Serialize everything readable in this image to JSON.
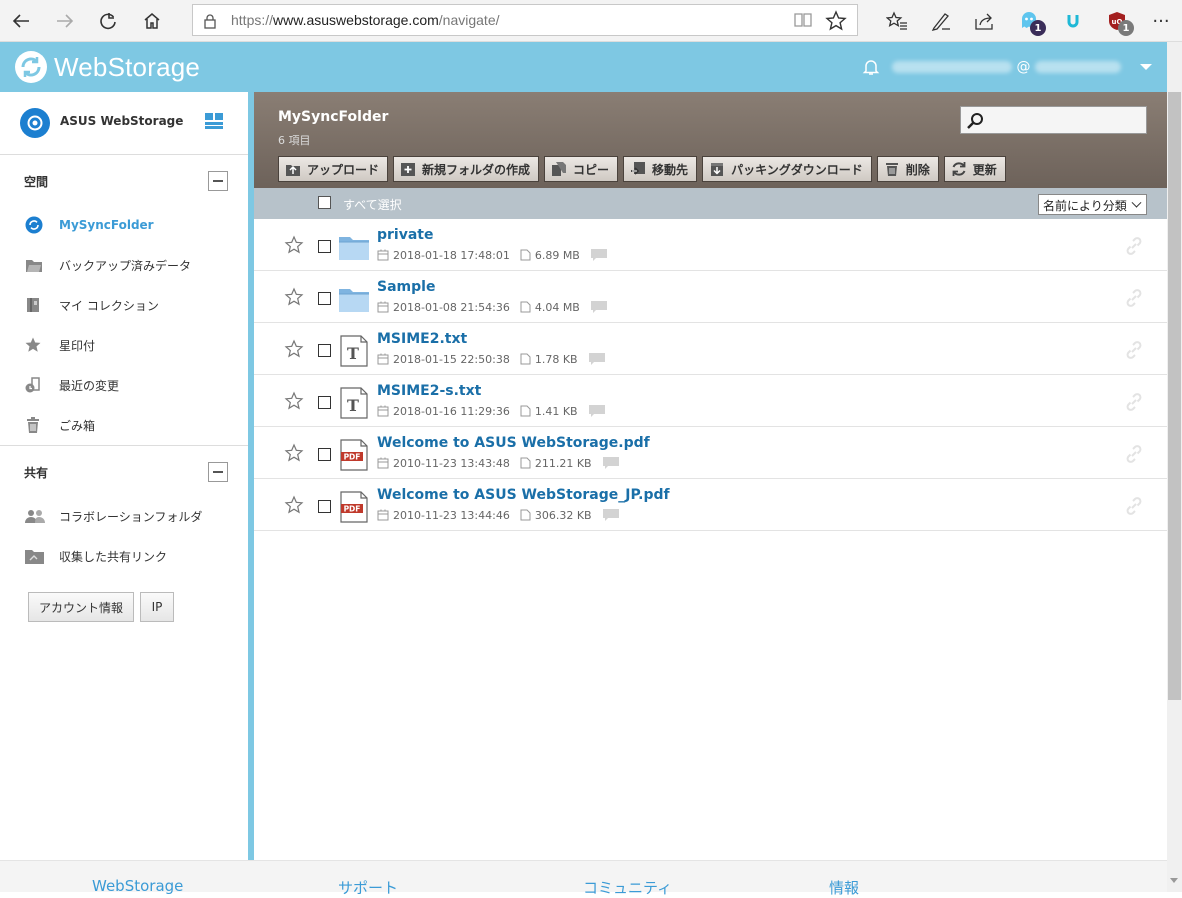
{
  "browser": {
    "url_prefix": "https://",
    "url_host": "www.asuswebstorage.com",
    "url_path": "/navigate/",
    "badge_ghostery": "1",
    "badge_ublock": "1",
    "more": "···"
  },
  "header": {
    "logo_text": "WebStorage",
    "user_at": "@"
  },
  "sidebar": {
    "brand": "ASUS WebStorage",
    "space_heading": "空間",
    "items": [
      {
        "label": "MySyncFolder",
        "icon": "sync-icon",
        "active": true
      },
      {
        "label": "バックアップ済みデータ",
        "icon": "backup-folder-icon"
      },
      {
        "label": "マイ コレクション",
        "icon": "collection-icon"
      },
      {
        "label": "星印付",
        "icon": "star-icon"
      },
      {
        "label": "最近の変更",
        "icon": "recent-changes-icon"
      },
      {
        "label": "ごみ箱",
        "icon": "trash-icon"
      }
    ],
    "shared_heading": "共有",
    "shared_items": [
      {
        "label": "コラボレーションフォルダ",
        "icon": "collaboration-icon"
      },
      {
        "label": "収集した共有リンク",
        "icon": "shared-link-folder-icon"
      }
    ],
    "account_button": "アカウント情報",
    "ip_button": "IP"
  },
  "main": {
    "folder_title": "MySyncFolder",
    "item_count": "6 項目",
    "toolbar": {
      "upload": "アップロード",
      "new_folder": "新規フォルダの作成",
      "copy": "コピー",
      "move": "移動先",
      "pack_download": "パッキングダウンロード",
      "delete": "削除",
      "refresh": "更新"
    },
    "select_all": "すべて選択",
    "sort_label": "名前により分類"
  },
  "files": [
    {
      "name": "private",
      "type": "folder",
      "date": "2018-01-18 17:48:01",
      "size": "6.89 MB"
    },
    {
      "name": "Sample",
      "type": "folder",
      "date": "2018-01-08 21:54:36",
      "size": "4.04 MB"
    },
    {
      "name": "MSIME2.txt",
      "type": "txt",
      "date": "2018-01-15 22:50:38",
      "size": "1.78 KB"
    },
    {
      "name": "MSIME2-s.txt",
      "type": "txt",
      "date": "2018-01-16 11:29:36",
      "size": "1.41 KB"
    },
    {
      "name": "Welcome to ASUS WebStorage.pdf",
      "type": "pdf",
      "date": "2010-11-23 13:43:48",
      "size": "211.21 KB"
    },
    {
      "name": "Welcome to ASUS WebStorage_JP.pdf",
      "type": "pdf",
      "date": "2010-11-23 13:44:46",
      "size": "306.32 KB"
    }
  ],
  "footer": {
    "links": [
      "WebStorage",
      "サポート",
      "コミュニティ",
      "情報"
    ]
  },
  "colors": {
    "header": "#7ec8e3",
    "accent": "#3b9bd6",
    "link": "#1a6fa8"
  }
}
